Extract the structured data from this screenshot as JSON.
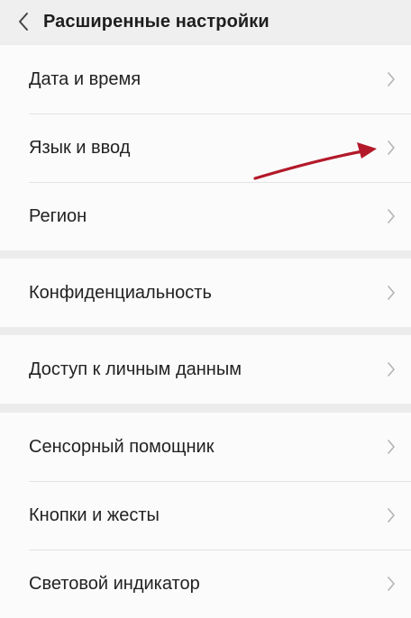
{
  "header": {
    "title": "Расширенные настройки",
    "back_icon": "chevron-left-icon"
  },
  "groups": [
    {
      "items": [
        {
          "label": "Дата и время",
          "icon": "chevron-right-icon"
        },
        {
          "label": "Язык и ввод",
          "icon": "chevron-right-icon"
        },
        {
          "label": "Регион",
          "icon": "chevron-right-icon"
        }
      ]
    },
    {
      "items": [
        {
          "label": "Конфиденциальность",
          "icon": "chevron-right-icon"
        }
      ]
    },
    {
      "items": [
        {
          "label": "Доступ к личным данным",
          "icon": "chevron-right-icon"
        }
      ]
    },
    {
      "items": [
        {
          "label": "Сенсорный помощник",
          "icon": "chevron-right-icon"
        },
        {
          "label": "Кнопки и жесты",
          "icon": "chevron-right-icon"
        },
        {
          "label": "Световой индикатор",
          "icon": "chevron-right-icon"
        }
      ]
    }
  ],
  "colors": {
    "background": "#ececec",
    "card": "#fbfbfb",
    "chevron": "#b3b3b3",
    "annotation_arrow": "#b3192a"
  }
}
